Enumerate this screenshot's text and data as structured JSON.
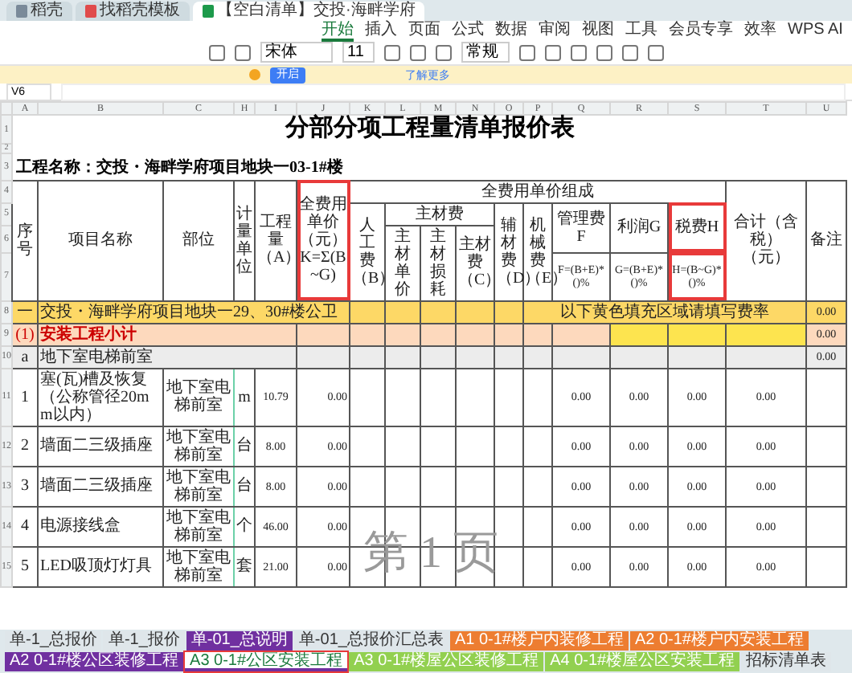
{
  "browser_tabs": [
    {
      "label": "稻壳",
      "kind": "plain",
      "selected": false
    },
    {
      "label": "找稻壳模板",
      "kind": "pdf",
      "selected": false
    },
    {
      "label": "【空白清单】交投·海畔学府",
      "kind": "sheet",
      "selected": true
    }
  ],
  "ribbon_tabs": [
    {
      "label": "开始",
      "selected": true
    },
    {
      "label": "插入",
      "selected": false
    },
    {
      "label": "页面",
      "selected": false
    },
    {
      "label": "公式",
      "selected": false
    },
    {
      "label": "数据",
      "selected": false
    },
    {
      "label": "审阅",
      "selected": false
    },
    {
      "label": "视图",
      "selected": false
    },
    {
      "label": "工具",
      "selected": false
    },
    {
      "label": "会员专享",
      "selected": false
    },
    {
      "label": "效率",
      "selected": false
    },
    {
      "label": "WPS AI",
      "selected": false
    }
  ],
  "ribbon": {
    "font": "宋体",
    "size": "11",
    "format": "常规"
  },
  "notice": {
    "button": "开启",
    "link": "了解更多"
  },
  "formula_bar": {
    "cell": "V6"
  },
  "columns": [
    "A",
    "B",
    "C",
    "H",
    "I",
    "J",
    "K",
    "L",
    "M",
    "N",
    "O",
    "P",
    "Q",
    "R",
    "S",
    "T",
    "U"
  ],
  "row_numbers": [
    "1",
    "2",
    "3",
    "4",
    "5",
    "6",
    "7",
    "8",
    "9",
    "10",
    "11",
    "12",
    "13",
    "14",
    "15"
  ],
  "sheet": {
    "title": "分部分项工程量清单报价表",
    "project": "工程名称：交投・海畔学府项目地块一03-1#楼",
    "headers": {
      "seq": "序号",
      "name": "项目名称",
      "part": "部位",
      "unit": "计量单位",
      "qty": "工程量（A）",
      "unit_price": "全费用单价（元）",
      "unit_price_f": "K=Σ(B~G)",
      "group": "全费用单价组成",
      "labor": "人工费（B）",
      "main": "主材费",
      "main_price": "主材单价",
      "main_loss": "主材损耗",
      "main_fee": "主材费（C）",
      "aux": "辅材费（D）",
      "mach": "机械费（E）",
      "mgmt": "管理费F",
      "mgmt_f": "F=(B+E)*()%",
      "profit": "利润G",
      "profit_f": "G=(B+E)*()%",
      "tax": "税费H",
      "tax_f": "H=(B~G)*()%",
      "total": "合计（含税）（元）",
      "note": "备注"
    },
    "boxed": {
      "unit_price": true,
      "tax": true
    },
    "rows": [
      {
        "kind": "section",
        "seq": "一",
        "name": "交投・海畔学府项目地块一29、30#楼公卫",
        "instruction": "以下黄色填充区域请填写费率",
        "total": "0.00"
      },
      {
        "kind": "subtotal",
        "seq": "(1)",
        "name": "安装工程小计",
        "total": "0.00"
      },
      {
        "kind": "group",
        "seq": "a",
        "name": "地下室电梯前室",
        "total": "0.00"
      },
      {
        "kind": "item",
        "seq": "1",
        "name": "塞(瓦)槽及恢复（公称管径20mm以内）",
        "part": "地下室电梯前室",
        "unit": "m",
        "qty": "10.79",
        "price": "0.00",
        "mgmt": "0.00",
        "profit": "0.00",
        "tax": "0.00",
        "total": "0.00"
      },
      {
        "kind": "item",
        "seq": "2",
        "name": "墙面二三级插座",
        "part": "地下室电梯前室",
        "unit": "台",
        "qty": "8.00",
        "price": "0.00",
        "mgmt": "0.00",
        "profit": "0.00",
        "tax": "0.00",
        "total": "0.00"
      },
      {
        "kind": "item",
        "seq": "3",
        "name": "墙面二三级插座",
        "part": "地下室电梯前室",
        "unit": "台",
        "qty": "8.00",
        "price": "0.00",
        "mgmt": "0.00",
        "profit": "0.00",
        "tax": "0.00",
        "total": "0.00"
      },
      {
        "kind": "item",
        "seq": "4",
        "name": "电源接线盒",
        "part": "地下室电梯前室",
        "unit": "个",
        "qty": "46.00",
        "price": "0.00",
        "mgmt": "0.00",
        "profit": "0.00",
        "tax": "0.00",
        "total": "0.00"
      },
      {
        "kind": "item",
        "seq": "5",
        "name": "LED吸顶灯灯具",
        "part": "地下室电梯前室",
        "unit": "套",
        "qty": "21.00",
        "price": "0.00",
        "mgmt": "0.00",
        "profit": "0.00",
        "tax": "0.00",
        "total": "0.00"
      }
    ]
  },
  "page_label": "第 1 页",
  "sheet_tabs": [
    {
      "label": "单-1_总报价",
      "color": "#dfe6ea",
      "selected": false,
      "boxed": false
    },
    {
      "label": "单-1_报价",
      "color": "#dfe6ea",
      "selected": false,
      "boxed": false
    },
    {
      "label": "单-01_总说明",
      "color": "#7030a0",
      "selected": false,
      "boxed": false
    },
    {
      "label": "单-01_总报价汇总表",
      "color": "#dfe6ea",
      "selected": false,
      "boxed": false
    },
    {
      "label": "A1 0-1#楼户内装修工程",
      "color": "#ed7d31",
      "selected": false,
      "boxed": false
    },
    {
      "label": "A2 0-1#楼户内安装工程",
      "color": "#ed7d31",
      "selected": false,
      "boxed": false
    },
    {
      "label": "A2 0-1#楼公区装修工程",
      "color": "#7030a0",
      "selected": false,
      "boxed": false
    },
    {
      "label": "A3 0-1#公区安装工程",
      "color": "#7030a0",
      "selected": true,
      "boxed": true
    },
    {
      "label": "A3 0-1#楼屋公区装修工程",
      "color": "#92d050",
      "selected": false,
      "boxed": false
    },
    {
      "label": "A4 0-1#楼屋公区安装工程",
      "color": "#92d050",
      "selected": false,
      "boxed": false
    },
    {
      "label": "招标清单表",
      "color": "#dfe6ea",
      "selected": false,
      "boxed": false
    }
  ]
}
